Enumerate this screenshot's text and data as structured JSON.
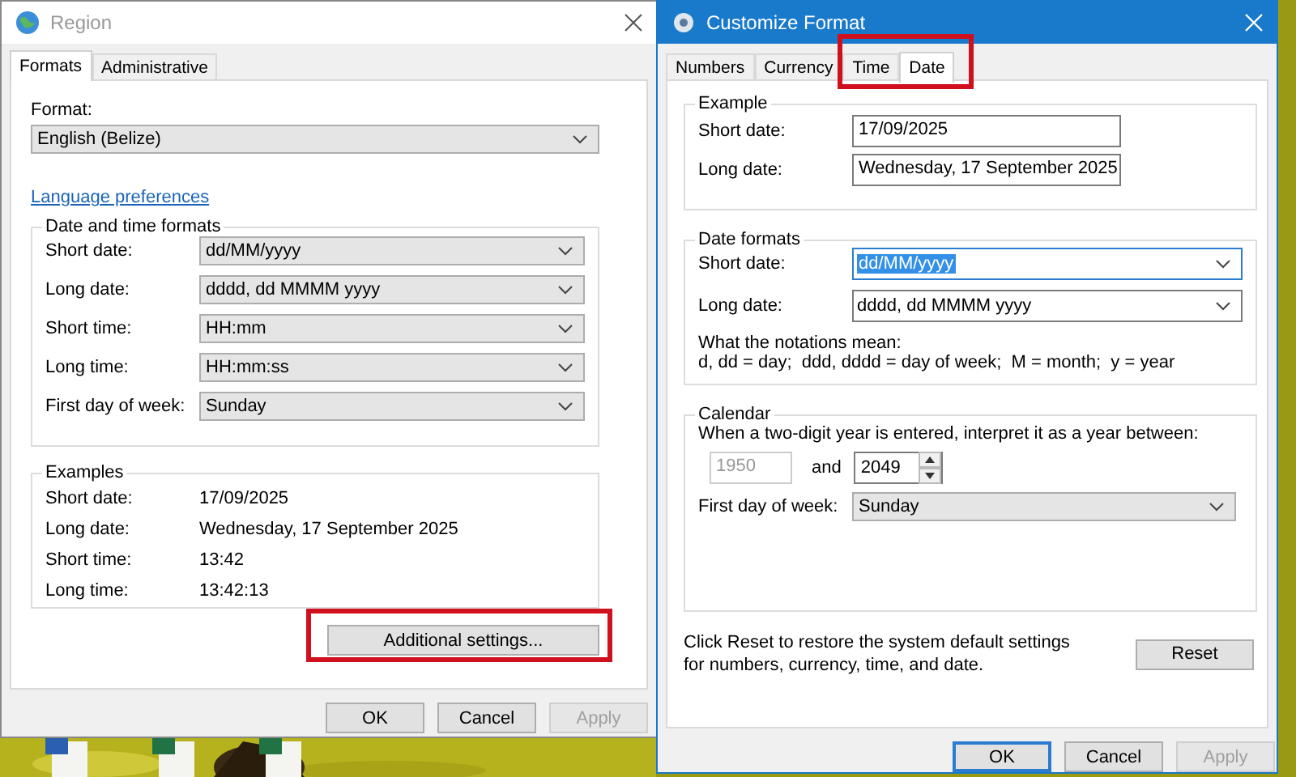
{
  "desktop": {
    "kind": "picture",
    "icons": [
      {
        "kind": "word"
      },
      {
        "kind": "excel"
      },
      {
        "kind": "excel"
      }
    ]
  },
  "region_window": {
    "title": "Region",
    "active": false,
    "tabs": [
      {
        "label": "Formats",
        "selected": true
      },
      {
        "label": "Administrative",
        "selected": false
      }
    ],
    "format": {
      "label": "Format:",
      "value": "English (Belize)"
    },
    "link": "Language preferences",
    "date_time_formats": {
      "title": "Date and time formats",
      "rows": [
        {
          "label": "Short date:",
          "value": "dd/MM/yyyy"
        },
        {
          "label": "Long date:",
          "value": "dddd, dd MMMM yyyy"
        },
        {
          "label": "Short time:",
          "value": "HH:mm"
        },
        {
          "label": "Long time:",
          "value": "HH:mm:ss"
        },
        {
          "label": "First day of week:",
          "value": "Sunday"
        }
      ]
    },
    "examples": {
      "title": "Examples",
      "rows": [
        {
          "label": "Short date:",
          "value": "17/09/2025"
        },
        {
          "label": "Long date:",
          "value": "Wednesday, 17 September 2025"
        },
        {
          "label": "Short time:",
          "value": "13:42"
        },
        {
          "label": "Long time:",
          "value": "13:42:13"
        }
      ]
    },
    "additional_settings": {
      "label": "Additional settings...",
      "highlighted": true
    },
    "buttons": [
      {
        "label": "OK",
        "disabled": false,
        "focused": false
      },
      {
        "label": "Cancel",
        "disabled": false,
        "focused": false
      },
      {
        "label": "Apply",
        "disabled": true,
        "focused": false
      }
    ]
  },
  "customize_window": {
    "title": "Customize Format",
    "active": true,
    "tabs": [
      {
        "label": "Numbers",
        "selected": false,
        "highlighted": false
      },
      {
        "label": "Currency",
        "selected": false,
        "highlighted": false
      },
      {
        "label": "Time",
        "selected": false,
        "highlighted": true
      },
      {
        "label": "Date",
        "selected": true,
        "highlighted": true
      }
    ],
    "example": {
      "title": "Example",
      "rows": [
        {
          "label": "Short date:",
          "value": "17/09/2025"
        },
        {
          "label": "Long date:",
          "value": "Wednesday, 17 September 2025"
        }
      ]
    },
    "date_formats": {
      "title": "Date formats",
      "rows": [
        {
          "label": "Short date:",
          "value": "dd/MM/yyyy",
          "focused": true
        },
        {
          "label": "Long date:",
          "value": "dddd, dd MMMM yyyy",
          "focused": false
        }
      ],
      "notation_title": "What the notations mean:",
      "notation_text": "d, dd = day;  ddd, dddd = day of week;  M = month;  y = year"
    },
    "calendar": {
      "title": "Calendar",
      "prompt": "When a two-digit year is entered, interpret it as a year between:",
      "year_from": {
        "value": "1950",
        "disabled": true
      },
      "and": "and",
      "year_to": "2049",
      "first_day": {
        "label": "First day of week:",
        "value": "Sunday"
      }
    },
    "reset_text": "Click Reset to restore the system default settings for numbers, currency, time, and date.",
    "reset_button": "Reset",
    "buttons": [
      {
        "label": "OK",
        "disabled": false,
        "focused": true
      },
      {
        "label": "Cancel",
        "disabled": false,
        "focused": false
      },
      {
        "label": "Apply",
        "disabled": true,
        "focused": false
      }
    ]
  }
}
